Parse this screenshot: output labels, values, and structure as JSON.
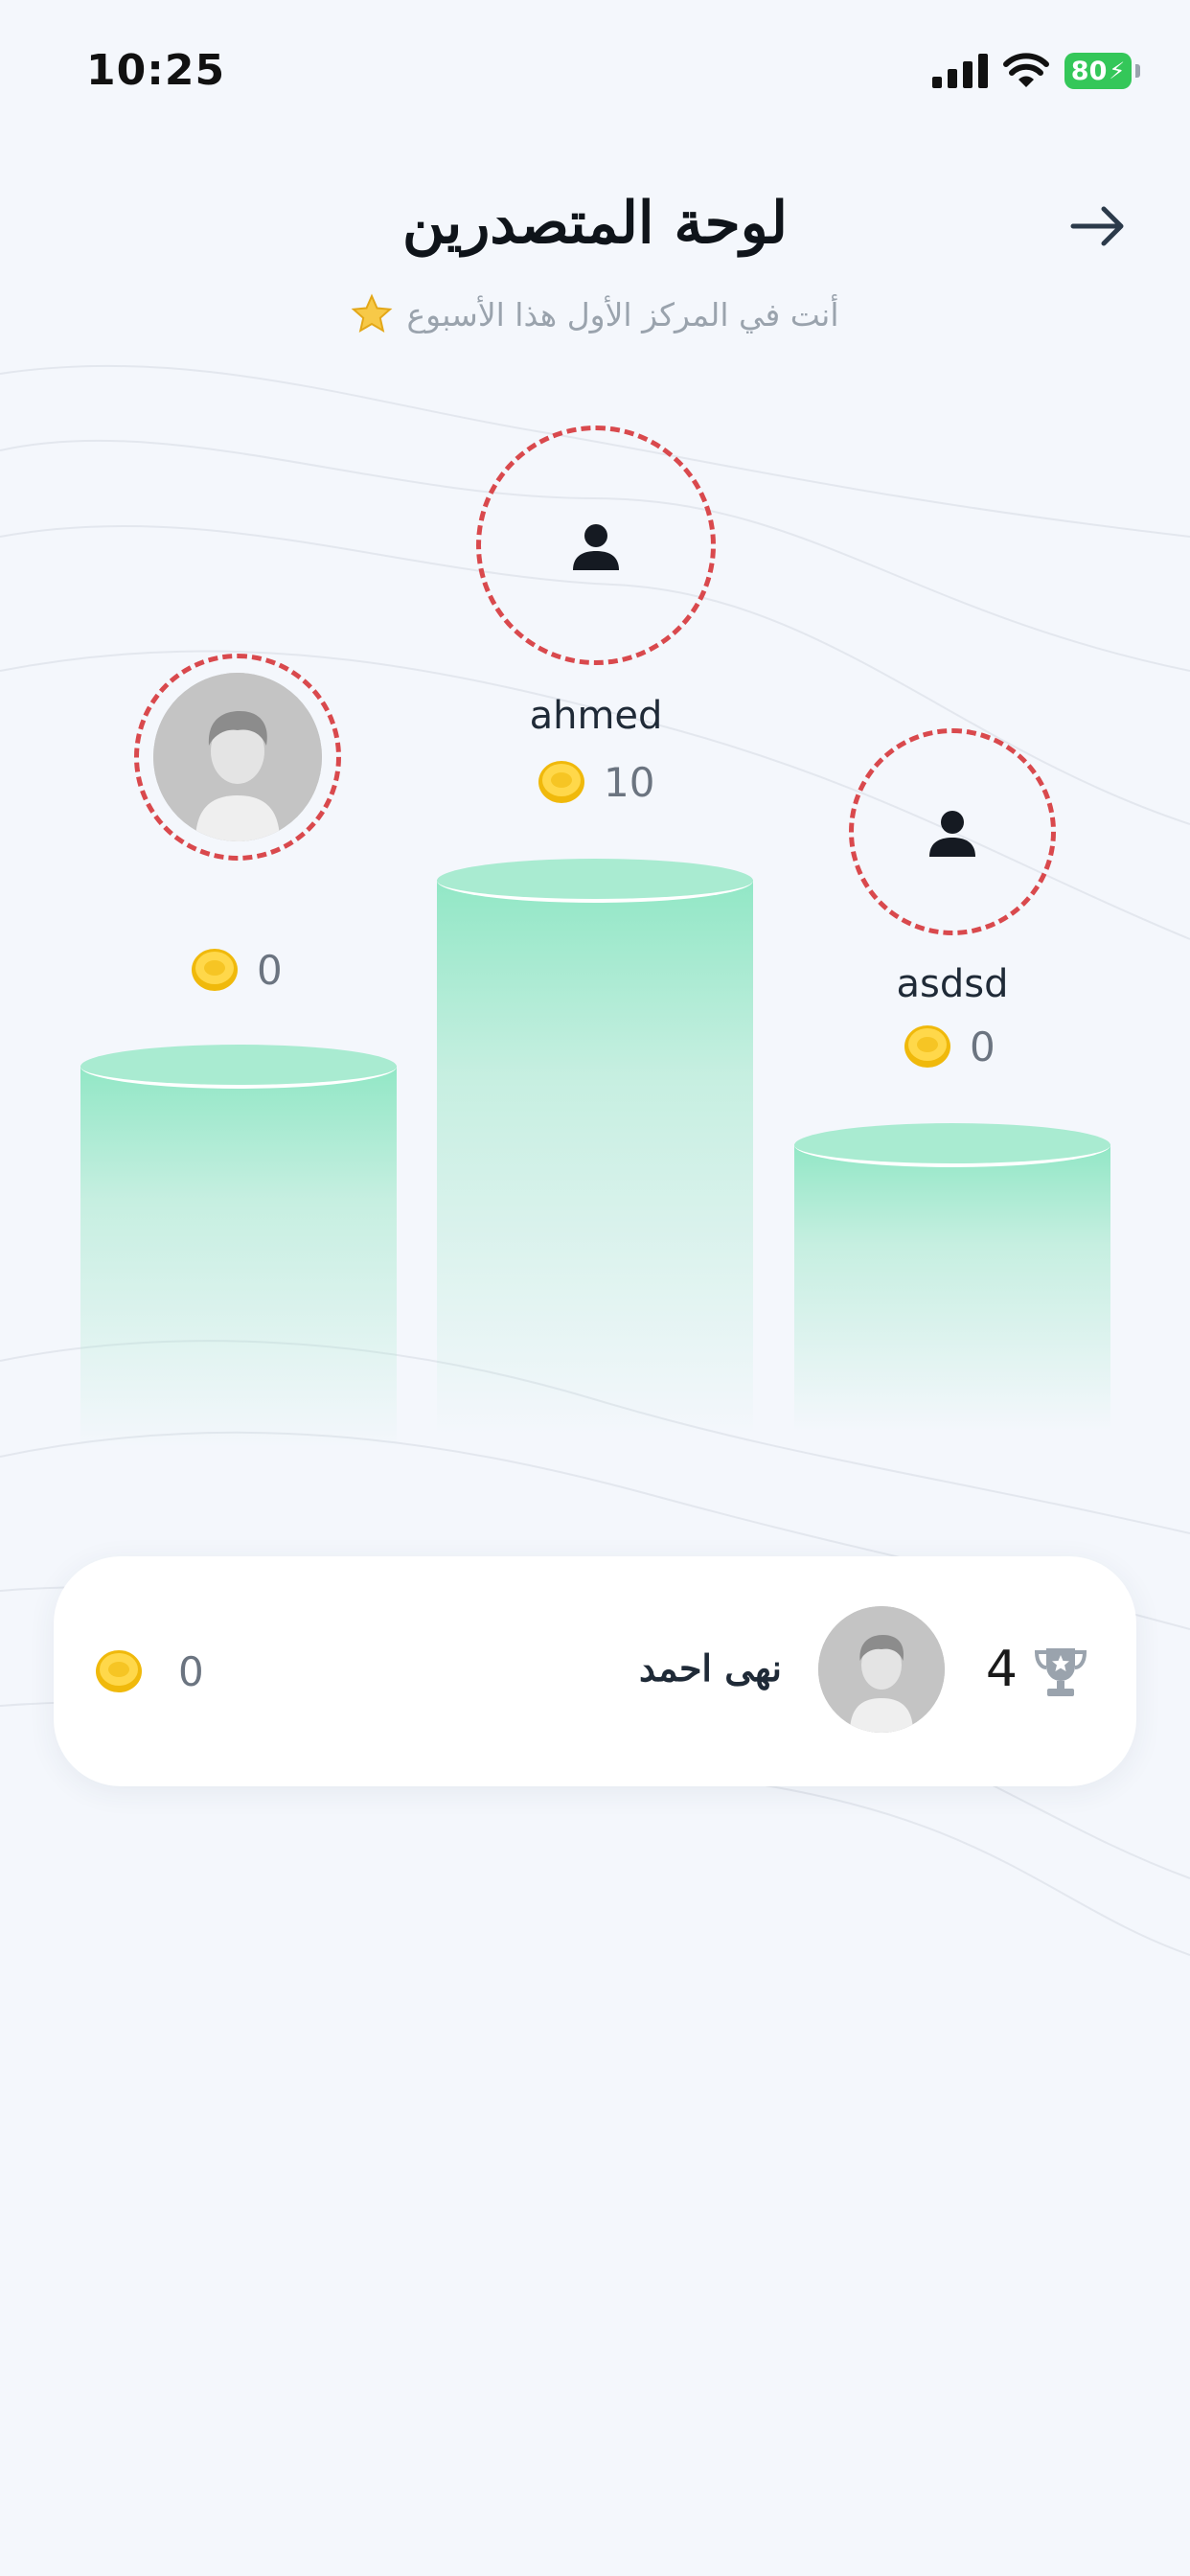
{
  "status_bar": {
    "time": "10:25",
    "battery": "80"
  },
  "header": {
    "title": "لوحة المتصدرين",
    "subtitle": "أنت في المركز الأول هذا الأسبوع"
  },
  "podium": {
    "first": {
      "name": "ahmed",
      "points": "10"
    },
    "second": {
      "name": "",
      "points": "0"
    },
    "third": {
      "name": "asdsd",
      "points": "0"
    }
  },
  "current_user": {
    "rank": "4",
    "name": "نهى احمد",
    "points": "0"
  },
  "colors": {
    "accent_ring": "#d9494d",
    "podium_green": "#a9ebd1",
    "coin_gold": "#f5c518",
    "battery_green": "#34c759"
  }
}
